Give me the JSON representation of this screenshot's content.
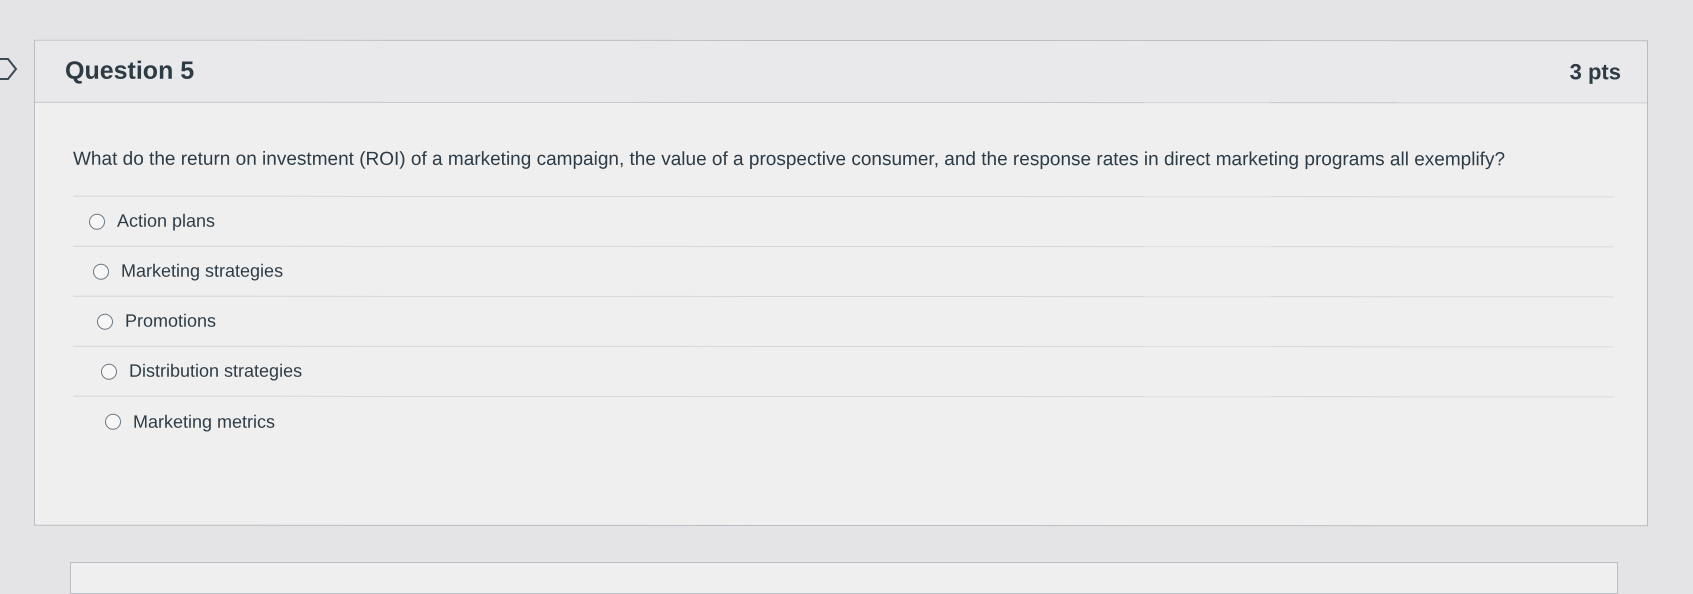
{
  "question": {
    "title": "Question 5",
    "points": "3 pts",
    "text": "What do the return on investment (ROI) of a marketing campaign, the value of a prospective consumer, and the response rates in direct marketing programs all exemplify?",
    "answers": [
      {
        "label": "Action plans"
      },
      {
        "label": "Marketing strategies"
      },
      {
        "label": "Promotions"
      },
      {
        "label": "Distribution strategies"
      },
      {
        "label": "Marketing metrics"
      }
    ]
  },
  "colors": {
    "text": "#2d3b45",
    "card_background": "#efeff0",
    "header_background": "#e9e9eb",
    "border": "#b9bcc0"
  }
}
